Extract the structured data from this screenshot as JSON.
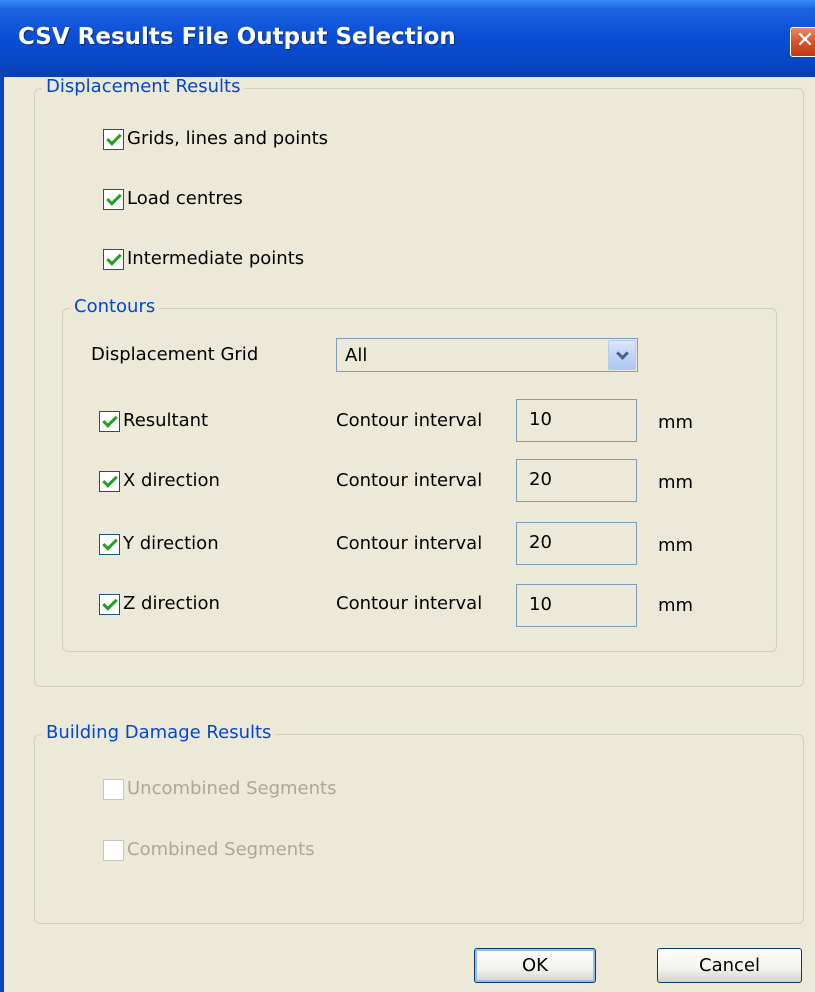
{
  "window": {
    "title": "CSV Results File Output Selection",
    "close_glyph": "✕"
  },
  "displacement": {
    "group_label": "Displacement Results",
    "options": [
      {
        "label": "Grids, lines and points",
        "checked": true
      },
      {
        "label": "Load centres",
        "checked": true
      },
      {
        "label": "Intermediate points",
        "checked": true
      }
    ],
    "contours": {
      "group_label": "Contours",
      "grid_label": "Displacement Grid",
      "grid_selected": "All",
      "rows": [
        {
          "label": "Resultant",
          "checked": true,
          "interval_label": "Contour interval",
          "value": "10",
          "unit": "mm"
        },
        {
          "label": "X direction",
          "checked": true,
          "interval_label": "Contour interval",
          "value": "20",
          "unit": "mm"
        },
        {
          "label": "Y direction",
          "checked": true,
          "interval_label": "Contour interval",
          "value": "20",
          "unit": "mm"
        },
        {
          "label": "Z direction",
          "checked": true,
          "interval_label": "Contour interval",
          "value": "10",
          "unit": "mm"
        }
      ]
    }
  },
  "damage": {
    "group_label": "Building Damage Results",
    "options": [
      {
        "label": "Uncombined Segments",
        "checked": false,
        "enabled": false
      },
      {
        "label": "Combined Segments",
        "checked": false,
        "enabled": false
      }
    ]
  },
  "buttons": {
    "ok": "OK",
    "cancel": "Cancel"
  },
  "colors": {
    "title_bar": "#0a4fd6",
    "dialog_bg": "#ece9d8",
    "group_label": "#0046d5",
    "check_mark": "#21a121",
    "disabled_text": "#aca899"
  }
}
